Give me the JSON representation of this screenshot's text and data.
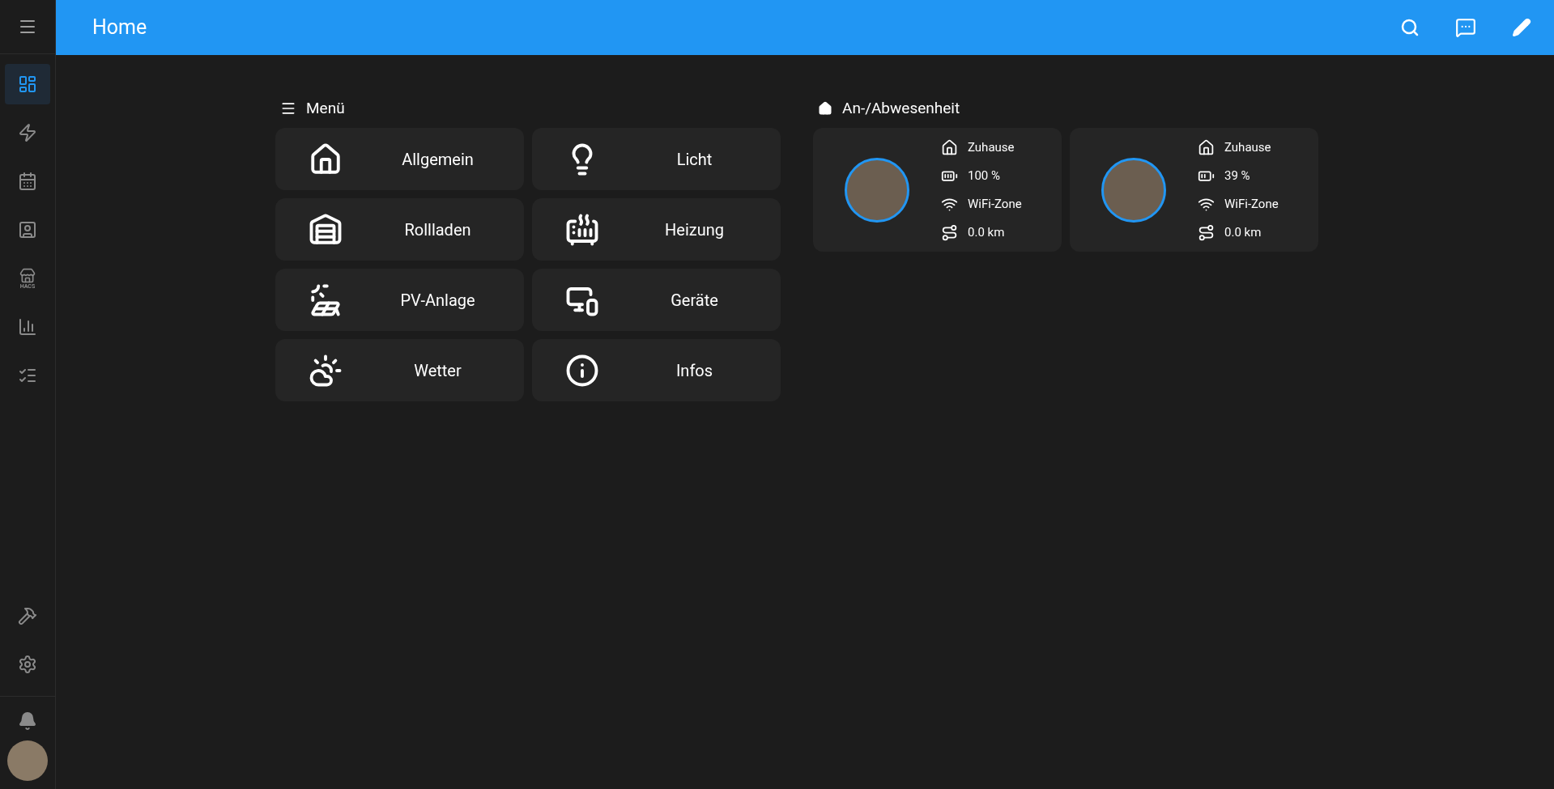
{
  "header": {
    "title": "Home"
  },
  "sidebar": {
    "items": [
      {
        "kind": "dashboard",
        "selected": true
      },
      {
        "kind": "energy",
        "selected": false
      },
      {
        "kind": "calendar",
        "selected": false
      },
      {
        "kind": "person",
        "selected": false
      },
      {
        "kind": "store",
        "selected": false,
        "caption": "HACS"
      },
      {
        "kind": "chart",
        "selected": false
      },
      {
        "kind": "list",
        "selected": false
      }
    ],
    "bottom_items": [
      {
        "kind": "hammer"
      },
      {
        "kind": "settings"
      }
    ]
  },
  "menu": {
    "title": "Menü",
    "tiles": [
      {
        "kind": "home",
        "label": "Allgemein"
      },
      {
        "kind": "light",
        "label": "Licht"
      },
      {
        "kind": "garage",
        "label": "Rollladen"
      },
      {
        "kind": "heater",
        "label": "Heizung"
      },
      {
        "kind": "solar",
        "label": "PV-Anlage"
      },
      {
        "kind": "devices",
        "label": "Geräte"
      },
      {
        "kind": "weather",
        "label": "Wetter"
      },
      {
        "kind": "info",
        "label": "Infos"
      }
    ]
  },
  "presence": {
    "title": "An-/Abwesenheit",
    "people": [
      {
        "status": "Zuhause",
        "battery": "100 %",
        "battery_full": true,
        "network": "WiFi-Zone",
        "distance": "0.0 km"
      },
      {
        "status": "Zuhause",
        "battery": "39 %",
        "battery_full": false,
        "network": "WiFi-Zone",
        "distance": "0.0 km"
      }
    ]
  }
}
